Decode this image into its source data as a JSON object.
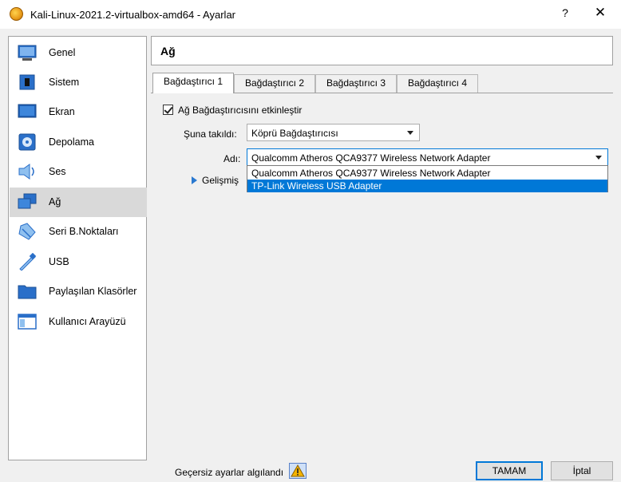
{
  "window": {
    "title": "Kali-Linux-2021.2-virtualbox-amd64 - Ayarlar",
    "help_label": "?",
    "close_label": "✕"
  },
  "sidebar": {
    "items": [
      {
        "label": "Genel",
        "icon": "general-icon"
      },
      {
        "label": "Sistem",
        "icon": "system-icon"
      },
      {
        "label": "Ekran",
        "icon": "display-icon"
      },
      {
        "label": "Depolama",
        "icon": "storage-icon"
      },
      {
        "label": "Ses",
        "icon": "audio-icon"
      },
      {
        "label": "Ağ",
        "icon": "network-icon",
        "selected": true
      },
      {
        "label": "Seri B.Noktaları",
        "icon": "serial-ports-icon"
      },
      {
        "label": "USB",
        "icon": "usb-icon"
      },
      {
        "label": "Paylaşılan Klasörler",
        "icon": "shared-folders-icon"
      },
      {
        "label": "Kullanıcı Arayüzü",
        "icon": "user-interface-icon"
      }
    ]
  },
  "section": {
    "title": "Ağ"
  },
  "tabs": [
    {
      "label": "Bağdaştırıcı 1",
      "active": true
    },
    {
      "label": "Bağdaştırıcı 2"
    },
    {
      "label": "Bağdaştırıcı 3"
    },
    {
      "label": "Bağdaştırıcı 4"
    }
  ],
  "adapter": {
    "enable_label": "Ağ Bağdaştırıcısını etkinleştir",
    "enabled": true,
    "attached_label": "Şuna takıldı:",
    "attached_value": "Köprü Bağdaştırıcısı",
    "name_label": "Adı:",
    "name_value": "Qualcomm Atheros QCA9377 Wireless Network Adapter",
    "name_options": [
      "Qualcomm Atheros QCA9377 Wireless Network Adapter",
      "TP-Link Wireless USB Adapter"
    ],
    "highlighted_option": 1,
    "advanced_label": "Gelişmiş"
  },
  "footer": {
    "invalid_settings": "Geçersiz ayarlar algılandı",
    "ok_label": "TAMAM",
    "cancel_label": "İptal"
  },
  "colors": {
    "accent": "#0078d7",
    "selected_item": "#d9d9d9"
  }
}
